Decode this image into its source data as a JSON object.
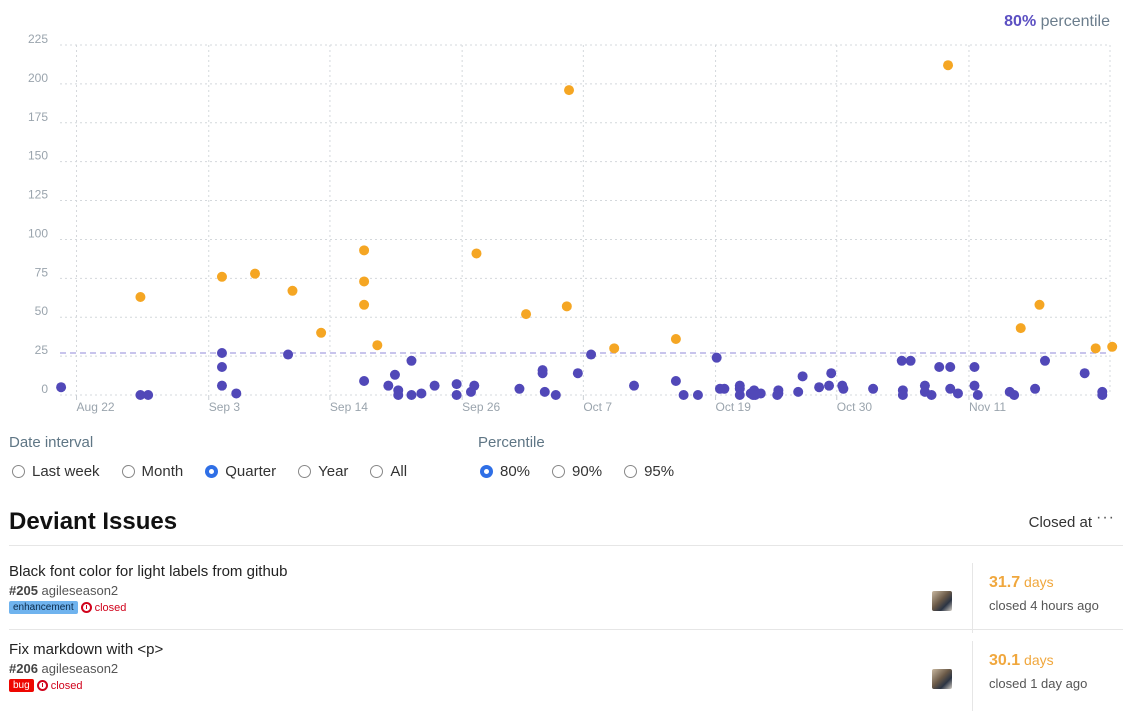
{
  "percentile_header": {
    "value": "80%",
    "label": "percentile"
  },
  "chart_data": {
    "type": "scatter",
    "y_ticks": [
      "0",
      "25",
      "50",
      "75",
      "100",
      "125",
      "150",
      "175",
      "200",
      "225"
    ],
    "ylim": [
      0,
      225
    ],
    "x_ticks": [
      "Aug 22",
      "Sep 3",
      "Sep 14",
      "Sep 26",
      "Oct 7",
      "Oct 19",
      "Oct 30",
      "Nov 11"
    ],
    "x_tick_days": [
      0,
      12,
      23,
      35,
      46,
      58,
      69,
      81
    ],
    "xlim": [
      -1.5,
      93.8
    ],
    "percentile_line": 27,
    "grid": true,
    "colors": {
      "normal": "#5148b8",
      "deviant": "#f5a623",
      "percentile_line": "#a7a1e0"
    },
    "series": [
      {
        "kind": "deviant",
        "points": [
          [
            5.8,
            63
          ],
          [
            13.2,
            76
          ],
          [
            16.2,
            78
          ],
          [
            19.6,
            67
          ],
          [
            22.2,
            40
          ],
          [
            26.1,
            93
          ],
          [
            26.1,
            73
          ],
          [
            26.1,
            58
          ],
          [
            27.3,
            32
          ],
          [
            36.3,
            91
          ],
          [
            40.8,
            52
          ],
          [
            44.7,
            196
          ],
          [
            44.5,
            57
          ],
          [
            48.8,
            30
          ],
          [
            54.4,
            36
          ],
          [
            79.1,
            212
          ],
          [
            85.7,
            43
          ],
          [
            87.4,
            58
          ],
          [
            92.5,
            30
          ],
          [
            94,
            31
          ]
        ]
      },
      {
        "kind": "normal",
        "points": [
          [
            -1.4,
            5
          ],
          [
            5.8,
            0
          ],
          [
            6.5,
            0
          ],
          [
            13.2,
            27
          ],
          [
            13.2,
            18
          ],
          [
            13.2,
            6
          ],
          [
            14.5,
            1
          ],
          [
            19.2,
            26
          ],
          [
            26.1,
            9
          ],
          [
            28.3,
            6
          ],
          [
            28.9,
            13
          ],
          [
            29.2,
            3
          ],
          [
            29.2,
            0
          ],
          [
            30.4,
            22
          ],
          [
            30.4,
            0
          ],
          [
            31.3,
            1
          ],
          [
            32.5,
            6
          ],
          [
            34.5,
            7
          ],
          [
            34.5,
            0
          ],
          [
            35.8,
            2
          ],
          [
            36.1,
            6
          ],
          [
            40.2,
            4
          ],
          [
            42.3,
            14
          ],
          [
            42.3,
            16
          ],
          [
            42.5,
            2
          ],
          [
            43.5,
            0
          ],
          [
            45.5,
            14
          ],
          [
            46.7,
            26
          ],
          [
            50.6,
            6
          ],
          [
            54.4,
            9
          ],
          [
            55.1,
            0
          ],
          [
            56.4,
            0
          ],
          [
            58.1,
            24
          ],
          [
            58.4,
            4
          ],
          [
            58.8,
            4
          ],
          [
            60.2,
            4
          ],
          [
            60.2,
            6
          ],
          [
            60.2,
            0
          ],
          [
            61.2,
            1
          ],
          [
            61.4,
            0
          ],
          [
            61.5,
            3
          ],
          [
            61.6,
            0
          ],
          [
            62.1,
            1
          ],
          [
            63.6,
            0
          ],
          [
            63.7,
            1
          ],
          [
            63.7,
            3
          ],
          [
            65.5,
            2
          ],
          [
            65.9,
            12
          ],
          [
            67.4,
            5
          ],
          [
            68.3,
            6
          ],
          [
            68.5,
            14
          ],
          [
            69.5,
            6
          ],
          [
            69.6,
            4
          ],
          [
            72.3,
            4
          ],
          [
            74.9,
            22
          ],
          [
            75.7,
            22
          ],
          [
            75,
            3
          ],
          [
            75,
            0
          ],
          [
            77,
            6
          ],
          [
            77,
            2
          ],
          [
            77.6,
            0
          ],
          [
            78.3,
            18
          ],
          [
            79.3,
            18
          ],
          [
            79.3,
            4
          ],
          [
            80,
            1
          ],
          [
            81.5,
            18
          ],
          [
            81.5,
            6
          ],
          [
            81.8,
            0
          ],
          [
            84.7,
            2
          ],
          [
            85.1,
            0
          ],
          [
            87,
            4
          ],
          [
            87.9,
            22
          ],
          [
            91.5,
            14
          ],
          [
            93.1,
            2
          ],
          [
            93.1,
            0
          ]
        ]
      }
    ]
  },
  "date_interval": {
    "title": "Date interval",
    "options": [
      "Last week",
      "Month",
      "Quarter",
      "Year",
      "All"
    ],
    "selected": "Quarter"
  },
  "percentile": {
    "title": "Percentile",
    "options": [
      "80%",
      "90%",
      "95%"
    ],
    "selected": "80%"
  },
  "issues_section": {
    "title": "Deviant Issues",
    "sort_label": "Closed at",
    "more_icon": "ellipsis-icon"
  },
  "issues": [
    {
      "title": "Black font color for light labels from github",
      "number": "#205",
      "repo": "agileseason2",
      "label": "enhancement",
      "label_color": "#6fb3ee",
      "label_text_color": "#0b2a4a",
      "state": "closed",
      "days": "31.7",
      "days_unit": "days",
      "closed_ago": "closed 4 hours ago"
    },
    {
      "title": "Fix markdown with <p>",
      "number": "#206",
      "repo": "agileseason2",
      "label": "bug",
      "label_color": "#ee0701",
      "label_text_color": "#ffffff",
      "state": "closed",
      "days": "30.1",
      "days_unit": "days",
      "closed_ago": "closed 1 day ago"
    }
  ]
}
